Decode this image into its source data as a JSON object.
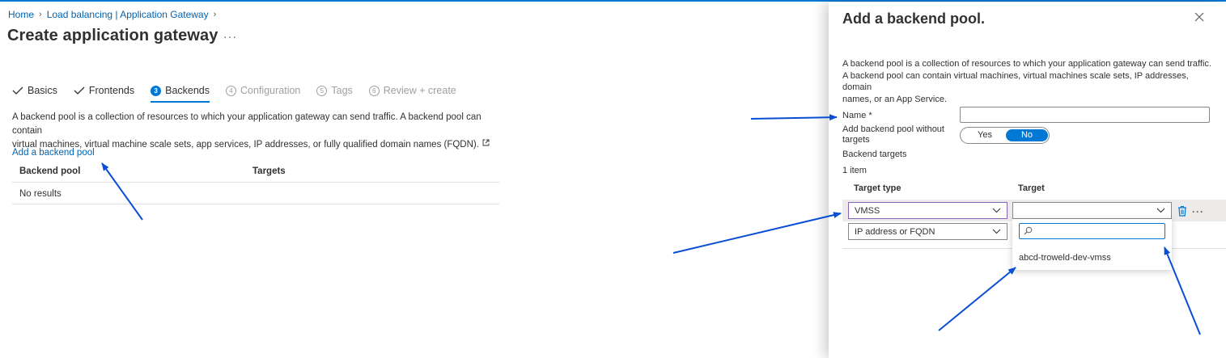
{
  "breadcrumb": [
    "Home",
    "Load balancing | Application Gateway"
  ],
  "page": {
    "title": "Create application gateway",
    "more": "···"
  },
  "steps": [
    {
      "label": "Basics",
      "state": "done"
    },
    {
      "label": "Frontends",
      "state": "done"
    },
    {
      "num": "3",
      "label": "Backends",
      "state": "current"
    },
    {
      "num": "4",
      "label": "Configuration",
      "state": "disabled"
    },
    {
      "num": "5",
      "label": "Tags",
      "state": "disabled"
    },
    {
      "num": "6",
      "label": "Review + create",
      "state": "disabled"
    }
  ],
  "main": {
    "description_line1": "A backend pool is a collection of resources to which your application gateway can send traffic. A backend pool can contain",
    "description_line2": "virtual machines, virtual machine scale sets, app services, IP addresses, or fully qualified domain names (FQDN).",
    "add_link": "Add a backend pool",
    "table": {
      "headers": [
        "Backend pool",
        "Targets"
      ],
      "empty": "No results"
    }
  },
  "panel": {
    "title": "Add a backend pool.",
    "description_line1": "A backend pool is a collection of resources to which your application gateway can send traffic.",
    "description_line2": "A backend pool can contain virtual machines, virtual machines scale sets, IP addresses, domain",
    "description_line3": "names, or an App Service.",
    "name_label": "Name *",
    "name_value": "",
    "without_targets_line1": "Add backend pool without",
    "without_targets_line2": "targets",
    "toggle_yes": "Yes",
    "toggle_no": "No",
    "toggle_selected": "No",
    "backend_targets_label": "Backend targets",
    "item_count": "1 item",
    "col_target_type": "Target type",
    "col_target": "Target",
    "row1_type": "VMSS",
    "row1_target": "",
    "row2_type": "IP address or FQDN",
    "search_value": "",
    "dropdown_option": "abcd-troweld-dev-vmss",
    "more": "···"
  },
  "colors": {
    "accent": "#0078d4",
    "link": "#0063b1",
    "annotation_arrow": "#0a4ed6",
    "focus_border": "#8764b8"
  }
}
